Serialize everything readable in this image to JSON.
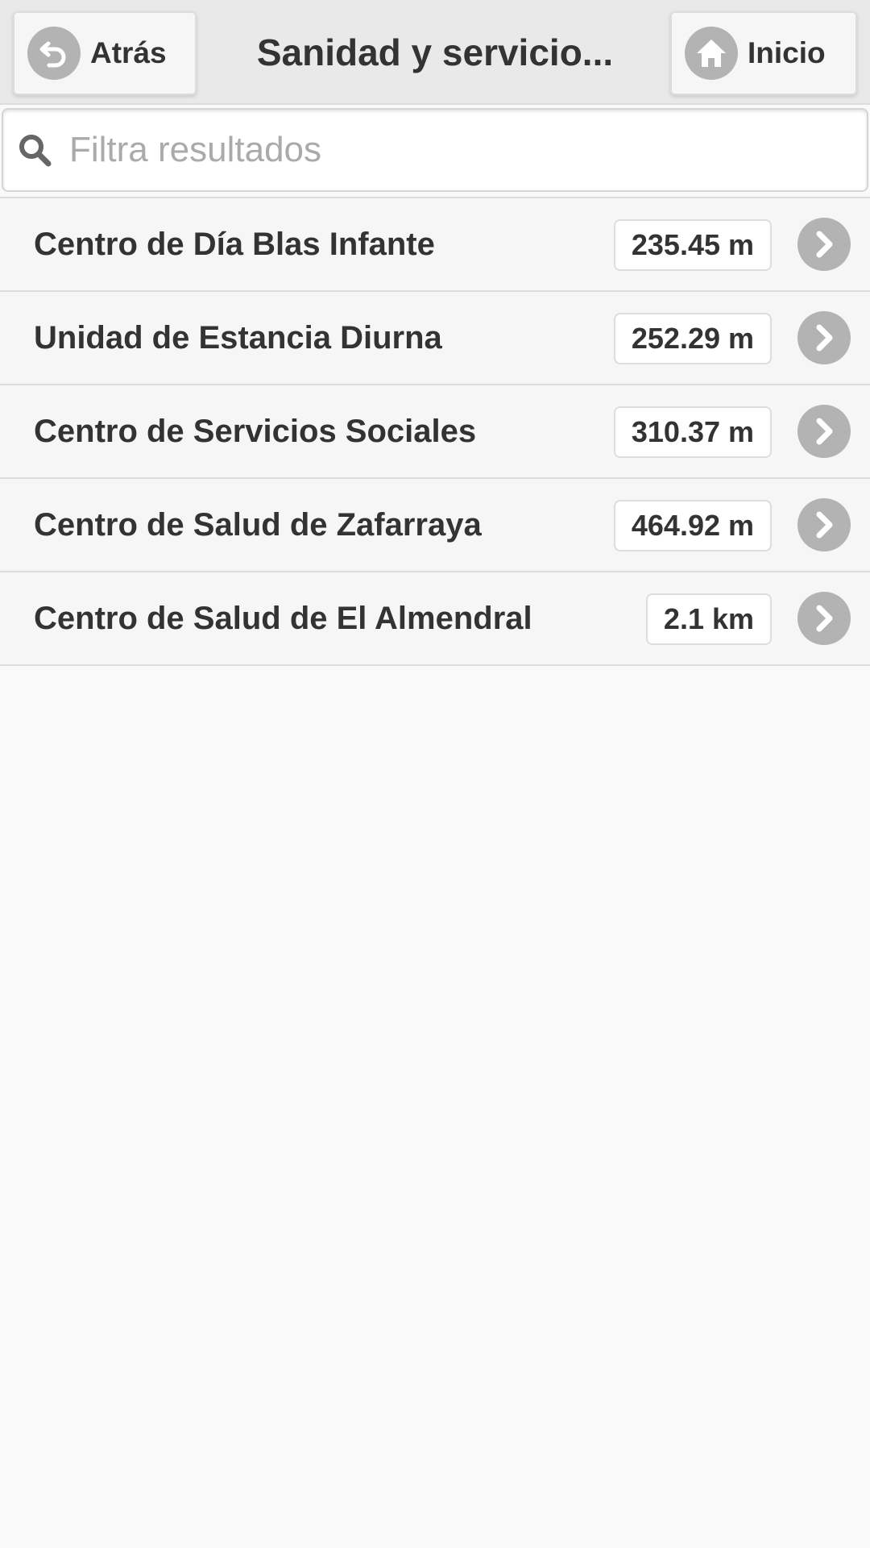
{
  "header": {
    "back_label": "Atrás",
    "title": "Sanidad y servicio...",
    "home_label": "Inicio"
  },
  "search": {
    "placeholder": "Filtra resultados",
    "value": ""
  },
  "icons": {
    "back": "back-arrow-icon",
    "home": "home-icon",
    "search": "search-icon",
    "row": "chevron-right-icon"
  },
  "colors": {
    "icon_bg": "#b3b3b3",
    "header_bg": "#e9e9e9",
    "row_bg": "#f6f6f6",
    "text": "#333333"
  },
  "results": [
    {
      "name": "Centro de Día Blas Infante",
      "distance": "235.45 m"
    },
    {
      "name": "Unidad de Estancia Diurna",
      "distance": "252.29 m"
    },
    {
      "name": "Centro de Servicios Sociales",
      "distance": "310.37 m"
    },
    {
      "name": "Centro de Salud de Zafarraya",
      "distance": "464.92 m"
    },
    {
      "name": "Centro de Salud de El Almendral",
      "distance": "2.1 km"
    }
  ]
}
